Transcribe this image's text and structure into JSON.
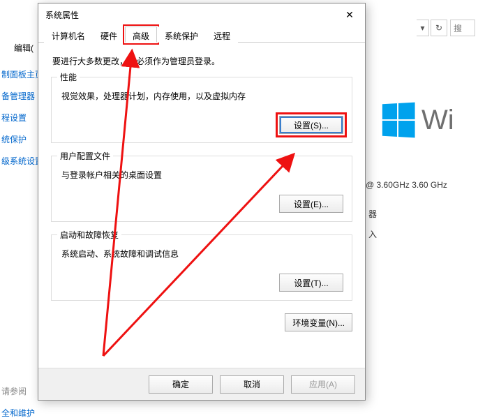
{
  "background": {
    "edit_label": "编辑(",
    "search_placeholder": "搜",
    "sidebar_items": [
      "制面板主页",
      "备管理器",
      "程设置",
      "统保护",
      "级系统设置"
    ],
    "sidebar_bottom": [
      "请参阅",
      "全和维护"
    ],
    "win_brand_text": "Wi",
    "cpu_line": "@ 3.60GHz   3.60 GHz",
    "right_items": [
      "器",
      "入"
    ]
  },
  "dialog": {
    "title": "系统属性",
    "tabs": [
      "计算机名",
      "硬件",
      "高级",
      "系统保护",
      "远程"
    ],
    "active_tab_index": 2,
    "admin_note": "要进行大多数更改，你必须作为管理员登录。",
    "group_performance": {
      "legend": "性能",
      "desc": "视觉效果，处理器计划，内存使用，以及虚拟内存",
      "button": "设置(S)..."
    },
    "group_profiles": {
      "legend": "用户配置文件",
      "desc": "与登录帐户相关的桌面设置",
      "button": "设置(E)..."
    },
    "group_startup": {
      "legend": "启动和故障恢复",
      "desc": "系统启动、系统故障和调试信息",
      "button": "设置(T)..."
    },
    "env_button": "环境变量(N)...",
    "footer": {
      "ok": "确定",
      "cancel": "取消",
      "apply": "应用(A)"
    }
  }
}
